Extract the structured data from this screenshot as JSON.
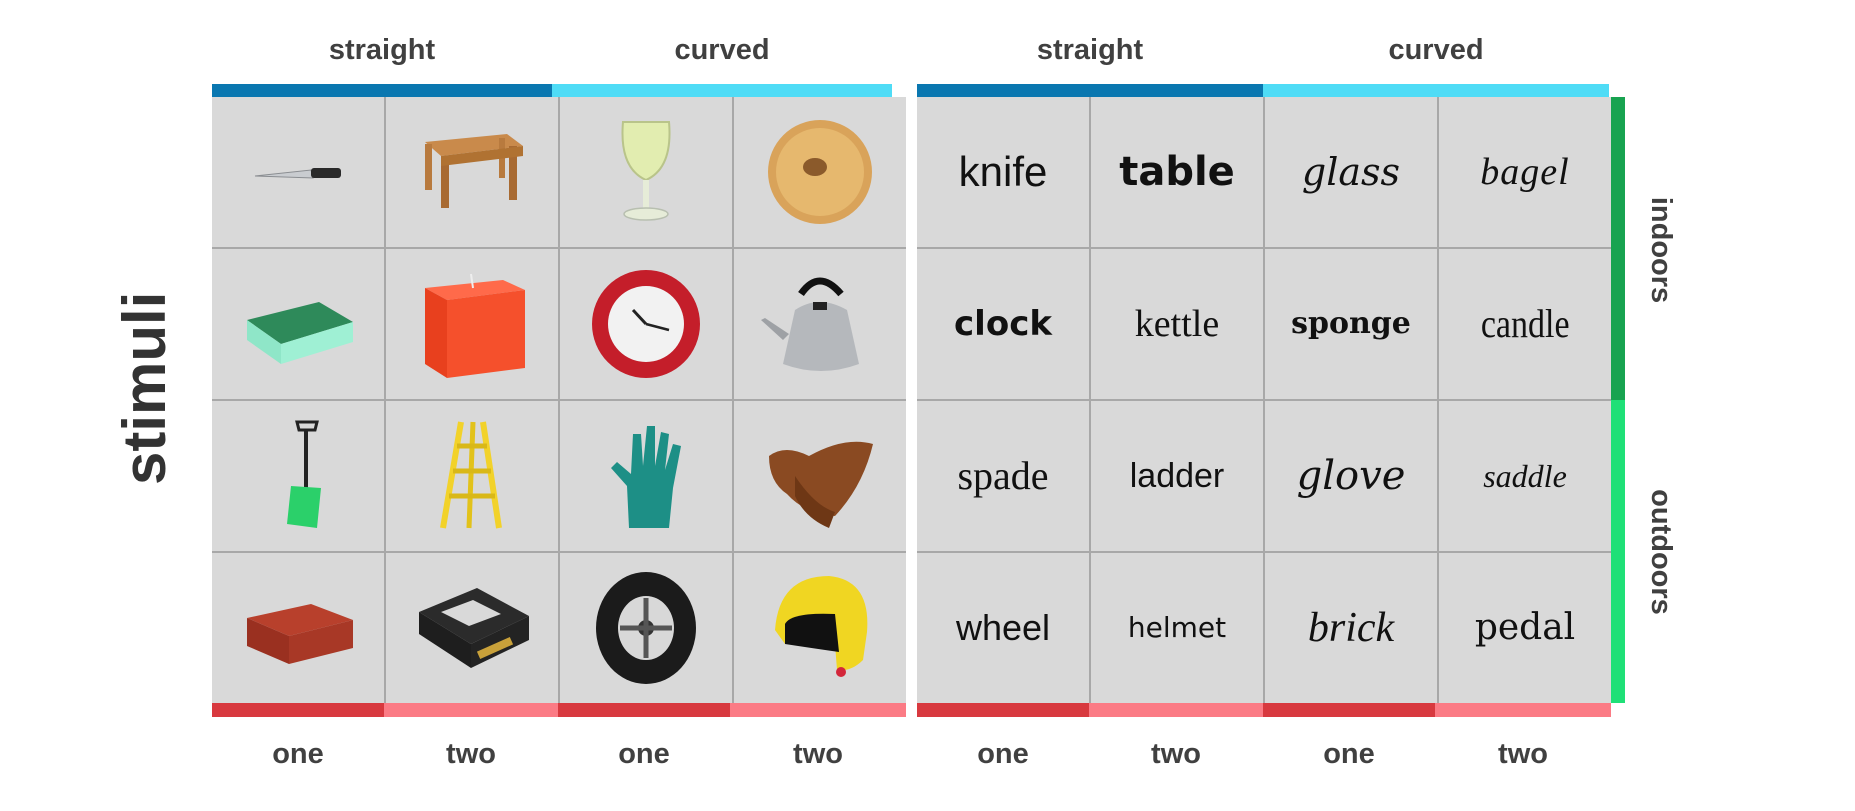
{
  "side_label": "stimuli",
  "left_panel": {
    "headers": [
      "straight",
      "curved"
    ],
    "footers": [
      "one",
      "two",
      "one",
      "two"
    ],
    "images": [
      [
        "knife",
        "table",
        "glass",
        "bagel"
      ],
      [
        "sponge",
        "candle",
        "clock",
        "kettle"
      ],
      [
        "spade",
        "ladder",
        "glove",
        "saddle"
      ],
      [
        "brick",
        "pedal",
        "wheel",
        "helmet"
      ]
    ]
  },
  "right_panel": {
    "headers": [
      "straight",
      "curved"
    ],
    "footers": [
      "one",
      "two",
      "one",
      "two"
    ],
    "words": [
      [
        "knife",
        "table",
        "glass",
        "bagel"
      ],
      [
        "clock",
        "kettle",
        "sponge",
        "candle"
      ],
      [
        "spade",
        "ladder",
        "glove",
        "saddle"
      ],
      [
        "wheel",
        "helmet",
        "brick",
        "pedal"
      ]
    ]
  },
  "row_groups": [
    "indoors",
    "outdoors"
  ],
  "colors": {
    "straight": "#0a77b0",
    "curved": "#4fdcf6",
    "one": "#d8393f",
    "two": "#fb7b85",
    "indoors": "#18a350",
    "outdoors": "#1fe077",
    "cell": "#d9d9d9"
  }
}
